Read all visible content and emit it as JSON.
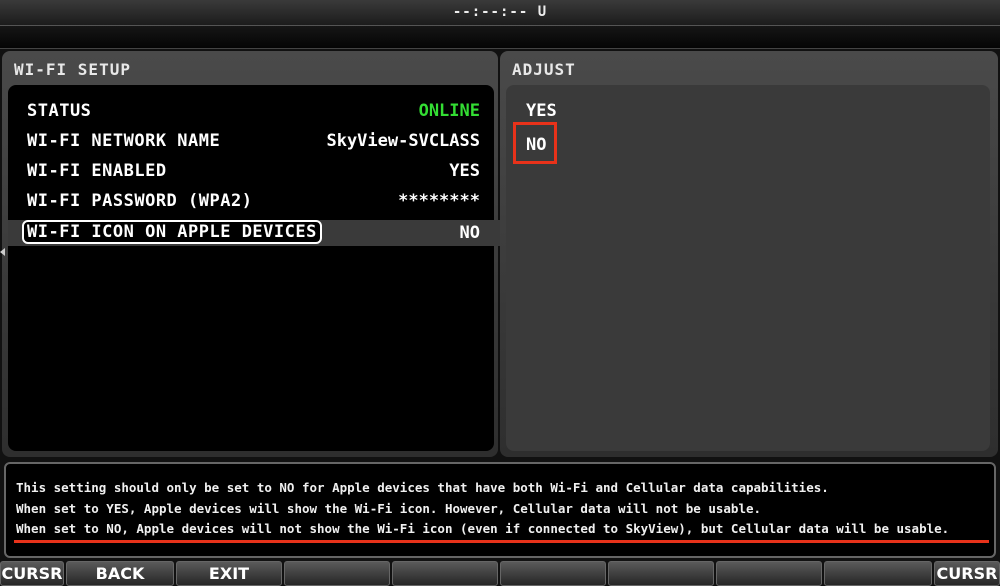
{
  "header": {
    "clock": "--:--:-- U"
  },
  "setup": {
    "title": "WI-FI SETUP",
    "rows": [
      {
        "label": "STATUS",
        "value": "ONLINE"
      },
      {
        "label": "WI-FI NETWORK NAME",
        "value": "SkyView-SVCLASS"
      },
      {
        "label": "WI-FI ENABLED",
        "value": "YES"
      },
      {
        "label": "WI-FI PASSWORD (WPA2)",
        "value": "********"
      },
      {
        "label": "WI-FI ICON ON APPLE DEVICES",
        "value": "NO"
      }
    ],
    "selected_row": 4
  },
  "adjust": {
    "title": "ADJUST",
    "options": [
      "YES",
      "NO"
    ],
    "selected": "NO"
  },
  "help": {
    "lines": [
      "This setting should only be set to NO for Apple devices that have both Wi-Fi and Cellular data capabilities.",
      "When set to YES, Apple devices will show the Wi-Fi icon. However, Cellular data will not be usable.",
      "When set to NO, Apple devices will not show the Wi-Fi icon (even if connected to SkyView), but Cellular data will be usable."
    ]
  },
  "softkeys": [
    "CURSR",
    "BACK",
    "EXIT",
    "",
    "",
    "",
    "",
    "",
    "",
    "CURSR"
  ],
  "colors": {
    "online": "#33dd33",
    "highlight": "#e8321a"
  }
}
